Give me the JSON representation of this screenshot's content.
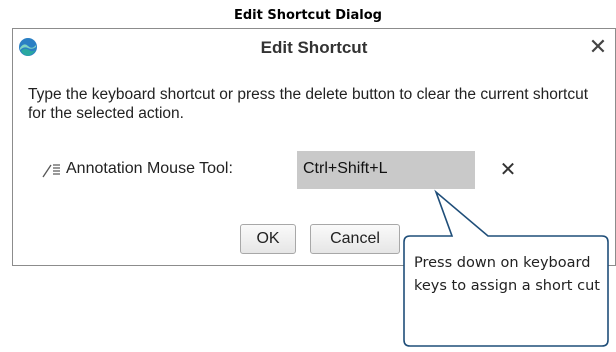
{
  "caption": "Edit Shortcut Dialog",
  "dialog": {
    "title": "Edit Shortcut",
    "close_glyph": "✕",
    "app_icon": "app-logo-icon",
    "instructions": "Type the keyboard shortcut or press the delete button to clear the current shortcut for the selected action.",
    "action": {
      "icon": "annotation-pen-icon",
      "label": "Annotation Mouse Tool:",
      "shortcut_value": "Ctrl+Shift+L",
      "clear_glyph": "✕"
    },
    "buttons": {
      "ok": "OK",
      "cancel": "Cancel"
    }
  },
  "callout": {
    "text": "Press down on keyboard keys to assign a short cut",
    "border_color": "#1f4e79"
  },
  "colors": {
    "field_bg": "#c9c9c9",
    "app_icon_teal": "#2aa8a0",
    "app_icon_blue": "#2a7fc4"
  }
}
